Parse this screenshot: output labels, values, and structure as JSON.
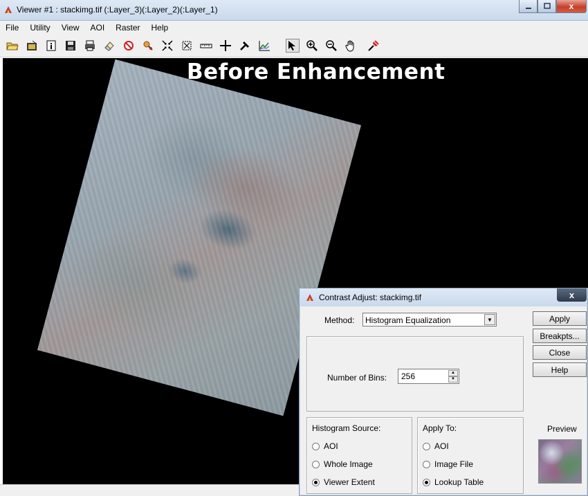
{
  "window": {
    "title": "Viewer #1 : stackimg.tif (:Layer_3)(:Layer_2)(:Layer_1)",
    "close_glyph": "x"
  },
  "menu": [
    "File",
    "Utility",
    "View",
    "AOI",
    "Raster",
    "Help"
  ],
  "toolbar": {
    "icons": [
      "open-icon",
      "open-layer-icon",
      "info-icon",
      "save-icon",
      "print-icon",
      "eraser-icon",
      "clear-view-icon",
      "inquire-icon",
      "zoom-fit-icon",
      "scale-icon",
      "measure-icon",
      "crosshair-icon",
      "pick-icon",
      "profile-icon",
      "select-arrow-icon",
      "zoom-in-icon",
      "zoom-out-icon",
      "pan-hand-icon",
      "link-icon"
    ]
  },
  "viewer": {
    "overlay_title": "Before Enhancement"
  },
  "dialog": {
    "title": "Contrast Adjust: stackimg.tif",
    "close_glyph": "x",
    "method_label": "Method:",
    "method_value": "Histogram Equalization",
    "bins_label": "Number of Bins:",
    "bins_value": "256",
    "buttons": {
      "apply": "Apply",
      "breakpts": "Breakpts...",
      "close": "Close",
      "help": "Help"
    },
    "histogram_source": {
      "label": "Histogram Source:",
      "options": [
        "AOI",
        "Whole Image",
        "Viewer Extent"
      ],
      "selected": "Viewer Extent"
    },
    "apply_to": {
      "label": "Apply To:",
      "options": [
        "AOI",
        "Image File",
        "Lookup Table"
      ],
      "selected": "Lookup Table"
    },
    "preview_label": "Preview"
  }
}
